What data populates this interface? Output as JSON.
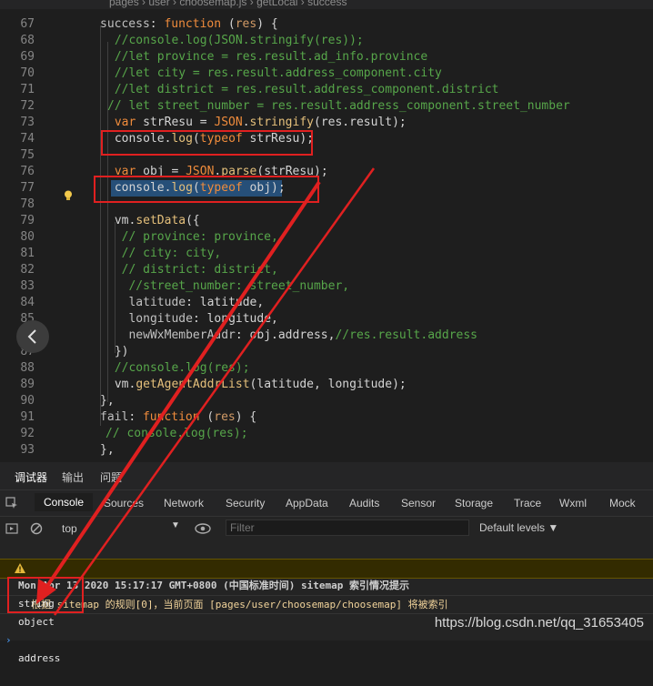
{
  "breadcrumb": {
    "text": "pages  ›  user  ›  choosemap.js  ›  getLocal  ›  success"
  },
  "editor": {
    "lines": [
      {
        "num": "67",
        "text": "success: function (res) {"
      },
      {
        "num": "68",
        "text": " //console.log(JSON.stringify(res));"
      },
      {
        "num": "69",
        "text": " //let province = res.result.ad_info.province"
      },
      {
        "num": "70",
        "text": " //let city = res.result.address_component.city"
      },
      {
        "num": "71",
        "text": " //let district = res.result.address_component.district"
      },
      {
        "num": "72",
        "text": "// let street_number = res.result.address_component.street_number"
      },
      {
        "num": "73",
        "text": " var strResu = JSON.stringify(res.result);"
      },
      {
        "num": "74",
        "text": " console.log(typeof strResu);"
      },
      {
        "num": "75",
        "text": ""
      },
      {
        "num": "76",
        "text": " var obj = JSON.parse(strResu);"
      },
      {
        "num": "77",
        "text": " console.log(typeof obj);"
      },
      {
        "num": "78",
        "text": ""
      },
      {
        "num": "79",
        "text": " vm.setData({"
      },
      {
        "num": "80",
        "text": "  // province: province,"
      },
      {
        "num": "81",
        "text": "  // city: city,"
      },
      {
        "num": "82",
        "text": "  // district: district,"
      },
      {
        "num": "83",
        "text": "   //street_number: street_number,"
      },
      {
        "num": "84",
        "text": "   latitude: latitude,"
      },
      {
        "num": "85",
        "text": "   longitude: longitude,"
      },
      {
        "num": "86",
        "text": "   newWxMemberAddr: obj.address,//res.result.address"
      },
      {
        "num": "87",
        "text": " })"
      },
      {
        "num": "88",
        "text": " //console.log(res);"
      },
      {
        "num": "89",
        "text": " vm.getAgentAddrList(latitude, longitude);"
      },
      {
        "num": "90",
        "text": "},"
      },
      {
        "num": "91",
        "text": "fail: function (res) {"
      },
      {
        "num": "92",
        "text": "// console.log(res);"
      },
      {
        "num": "93",
        "text": "},"
      }
    ]
  },
  "panel": {
    "tabs": [
      "调试器",
      "输出",
      "问题"
    ]
  },
  "devtools": {
    "tabs": [
      "Console",
      "Sources",
      "Network",
      "Security",
      "AppData",
      "Audits",
      "Sensor",
      "Storage",
      "Trace",
      "Wxml",
      "Mock"
    ],
    "context": "top",
    "filter_placeholder": "Filter",
    "levels": "Default levels ▼"
  },
  "console": {
    "group": "Mon Apr 13 2020 15:17:17 GMT+0800 (中国标准时间) sitemap 索引情况提示",
    "warning": "根据 sitemap 的规则[0]，当前页面 [pages/user/choosemap/choosemap] 将被索引",
    "logs": [
      "string",
      "object"
    ],
    "prompt": "address"
  },
  "watermark": "https://blog.csdn.net/qq_31653405",
  "colors": {
    "highlight_box": "#e02020",
    "selection": "#264f78",
    "warning_bg": "#332b00"
  }
}
